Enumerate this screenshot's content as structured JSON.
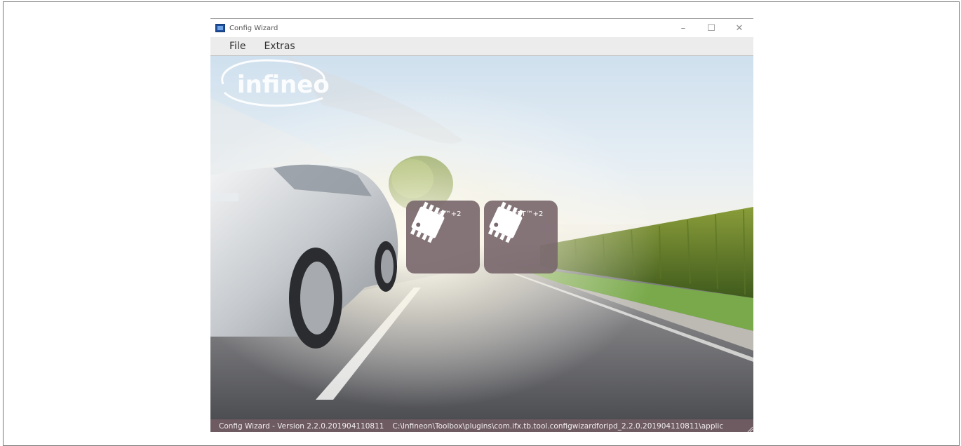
{
  "window": {
    "title": "Config Wizard",
    "icon": "config-wizard-app-icon",
    "controls": {
      "minimize": "–",
      "maximize": "☐",
      "close": "✕"
    }
  },
  "menu": {
    "items": [
      {
        "label": "File"
      },
      {
        "label": "Extras"
      }
    ]
  },
  "products": [
    {
      "label": "SPOC™+2",
      "icon": "chip-icon"
    },
    {
      "label": "PROFET™+2",
      "icon": "chip-icon"
    }
  ],
  "brand": {
    "logo_text": "infineon",
    "logo_color": "#ffffff"
  },
  "status_bar": {
    "version_text": "Config Wizard - Version 2.2.0.201904110811",
    "path_text": "C:\\Infineon\\Toolbox\\plugins\\com.ifx.tb.tool.configwizardforipd_2.2.0.201904110811\\applic"
  },
  "colors": {
    "tile_bg": "#79686e",
    "status_bg": "#6d5b61",
    "menu_bg": "#ececec"
  }
}
